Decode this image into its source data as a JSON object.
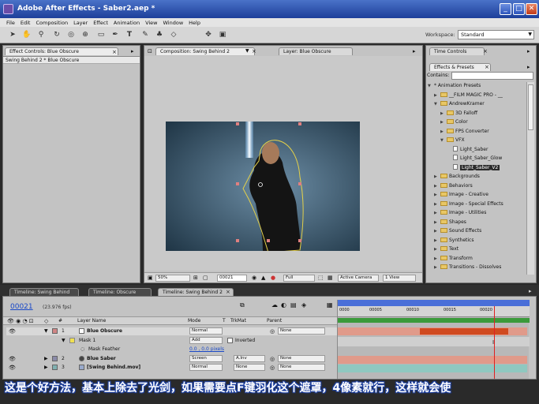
{
  "app": {
    "title": "Adobe After Effects - Saber2.aep *"
  },
  "menu": [
    "File",
    "Edit",
    "Composition",
    "Layer",
    "Effect",
    "Animation",
    "View",
    "Window",
    "Help"
  ],
  "workspace": {
    "label": "Workspace:",
    "value": "Standard"
  },
  "effect_controls": {
    "tab": "Effect Controls: Blue Obscure",
    "breadcrumb": "Swing Behind 2 * Blue Obscure"
  },
  "composition": {
    "tab": "Composition: Swing Behind 2",
    "layer_tab": "Layer: Blue Obscure",
    "zoom": "50%",
    "timecode": "00021",
    "resolution": "Full",
    "camera": "Active Camera",
    "views": "1 View"
  },
  "right_panel": {
    "tab1": "Time Controls",
    "tab2": "Effects & Presets",
    "contains_label": "Contains:",
    "tree": [
      {
        "label": "* Animation Presets",
        "depth": 0,
        "kind": "root",
        "open": true
      },
      {
        "label": "__FILM MAGIC PRO - __",
        "depth": 1,
        "kind": "folder"
      },
      {
        "label": "AndrewKramer",
        "depth": 1,
        "kind": "folder",
        "open": true
      },
      {
        "label": "3D Falloff",
        "depth": 2,
        "kind": "folder"
      },
      {
        "label": "Color",
        "depth": 2,
        "kind": "folder"
      },
      {
        "label": "FPS Converter",
        "depth": 2,
        "kind": "folder"
      },
      {
        "label": "VFX",
        "depth": 2,
        "kind": "folder",
        "open": true
      },
      {
        "label": "Light_Saber",
        "depth": 3,
        "kind": "file"
      },
      {
        "label": "Light_Saber_Glow",
        "depth": 3,
        "kind": "file"
      },
      {
        "label": "Light_Saber_V2",
        "depth": 3,
        "kind": "file",
        "selected": true
      },
      {
        "label": "Backgrounds",
        "depth": 1,
        "kind": "folder"
      },
      {
        "label": "Behaviors",
        "depth": 1,
        "kind": "folder"
      },
      {
        "label": "Image - Creative",
        "depth": 1,
        "kind": "folder"
      },
      {
        "label": "Image - Special Effects",
        "depth": 1,
        "kind": "folder"
      },
      {
        "label": "Image - Utilities",
        "depth": 1,
        "kind": "folder"
      },
      {
        "label": "Shapes",
        "depth": 1,
        "kind": "folder"
      },
      {
        "label": "Sound Effects",
        "depth": 1,
        "kind": "folder"
      },
      {
        "label": "Synthetics",
        "depth": 1,
        "kind": "folder"
      },
      {
        "label": "Text",
        "depth": 1,
        "kind": "folder"
      },
      {
        "label": "Transform",
        "depth": 1,
        "kind": "folder"
      },
      {
        "label": "Transitions - Dissolves",
        "depth": 1,
        "kind": "folder"
      }
    ]
  },
  "timeline": {
    "tabs": [
      "Timeline: Swing Behind",
      "Timeline: Obscure",
      "Timeline: Swing Behind 2"
    ],
    "timecode": "00021",
    "fps": "(23.976 fps)",
    "headers": {
      "num": "#",
      "name": "Layer Name",
      "mode": "Mode",
      "t": "T",
      "trkmat": "TrkMat",
      "parent": "Parent"
    },
    "ruler": [
      "0000",
      "00005",
      "00010",
      "00015",
      "00020"
    ],
    "layers": [
      {
        "num": "1",
        "name": "Blue Obscure",
        "mode": "Normal",
        "trkmat": "",
        "parent": "None",
        "swatch": "#d08585"
      },
      {
        "num": "2",
        "name": "Blue Saber",
        "mode": "Screen",
        "trkmat": "A.Inv",
        "parent": "None",
        "swatch": "#8a8aa8"
      },
      {
        "num": "3",
        "name": "[Swing Behind.mov]",
        "mode": "Normal",
        "trkmat": "None",
        "parent": "None",
        "swatch": "#7fb0b0"
      }
    ],
    "mask": {
      "name": "Mask 1",
      "mode": "Add",
      "inverted": "Inverted",
      "feather_label": "Mask Feather",
      "feather_value": "0.0 , 0.0 pixels"
    }
  },
  "subtitle": "这是个好方法，基本上除去了光剑，如果需要点F键羽化这个遮罩，4像素就行，这样就会使"
}
